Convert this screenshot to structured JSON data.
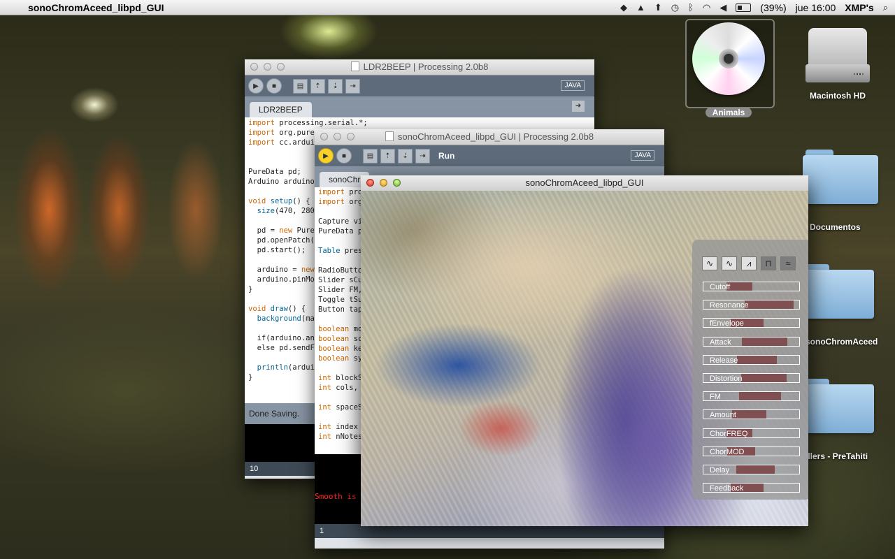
{
  "menubar": {
    "app_name": "sonoChromAceed_libpd_GUI",
    "battery": "(39%)",
    "clock": "jue 16:00",
    "user": "XMP's",
    "apple_icon": "apple-icon"
  },
  "desktop": {
    "animals": "Animals",
    "macintosh_hd": "Macintosh HD",
    "documentos": "Documentos",
    "sonochromaceed": "sonoChromAceed",
    "pretahiti": "illers - PreTahiti"
  },
  "win_ldr": {
    "title": "LDR2BEEP | Processing 2.0b8",
    "java": "JAVA",
    "tab": "LDR2BEEP",
    "message": "Done Saving.",
    "line": "10",
    "code": [
      "import processing.serial.*;",
      "import org.pured",
      "import cc.arduin",
      "",
      "",
      "PureData pd;",
      "Arduino arduino;",
      "",
      "void setup() {",
      "  size(470, 280)",
      "",
      "  pd = new PureD",
      "  pd.openPatch(\"",
      "  pd.start();",
      "",
      "  arduino = new",
      "  arduino.pinMod",
      "}",
      "",
      "void draw() {",
      "  background(map",
      "",
      "  if(arduino.ana",
      "  else pd.sendFl",
      "",
      "  println(arduin",
      "}"
    ]
  },
  "win_sono": {
    "title": "sonoChromAceed_libpd_GUI | Processing 2.0b8",
    "java": "JAVA",
    "run_label": "Run",
    "tab": "sonoChr",
    "error": "Smooth is n",
    "line": "1",
    "code": [
      "import pro",
      "import org",
      "",
      "Capture vi",
      "PureData p",
      "",
      "Table pres",
      "",
      "RadioButto",
      "Slider sCu",
      "Slider FM,",
      "Toggle tSu",
      "Button tap",
      "",
      "boolean mo",
      "boolean sc",
      "boolean ke",
      "boolean sy",
      "",
      "int blockS",
      "int cols,",
      "",
      "int spaceS",
      "",
      "int index",
      "int nNotes"
    ]
  },
  "sketch": {
    "title": "sonoChromAceed_libpd_GUI",
    "waves": [
      "sine-wave-icon",
      "soft-sine-wave-icon",
      "sawtooth-wave-icon",
      "square-wave-icon",
      "noise-wave-icon"
    ],
    "sliders": [
      {
        "label": "Cutoff",
        "value": 0.52
      },
      {
        "label": "Resonance",
        "value": 0.94
      },
      {
        "label": "fEnvelope",
        "value": 0.63
      },
      {
        "label": "Attack",
        "value": 0.88
      },
      {
        "label": "Release",
        "value": 0.77
      },
      {
        "label": "Distortion",
        "value": 0.87
      },
      {
        "label": "FM",
        "value": 0.81
      },
      {
        "label": "Amount",
        "value": 0.66
      },
      {
        "label": "ChorFREQ",
        "value": 0.52
      },
      {
        "label": "ChorMOD",
        "value": 0.55
      },
      {
        "label": "Delay",
        "value": 0.75
      },
      {
        "label": "Feedback",
        "value": 0.63
      }
    ]
  }
}
